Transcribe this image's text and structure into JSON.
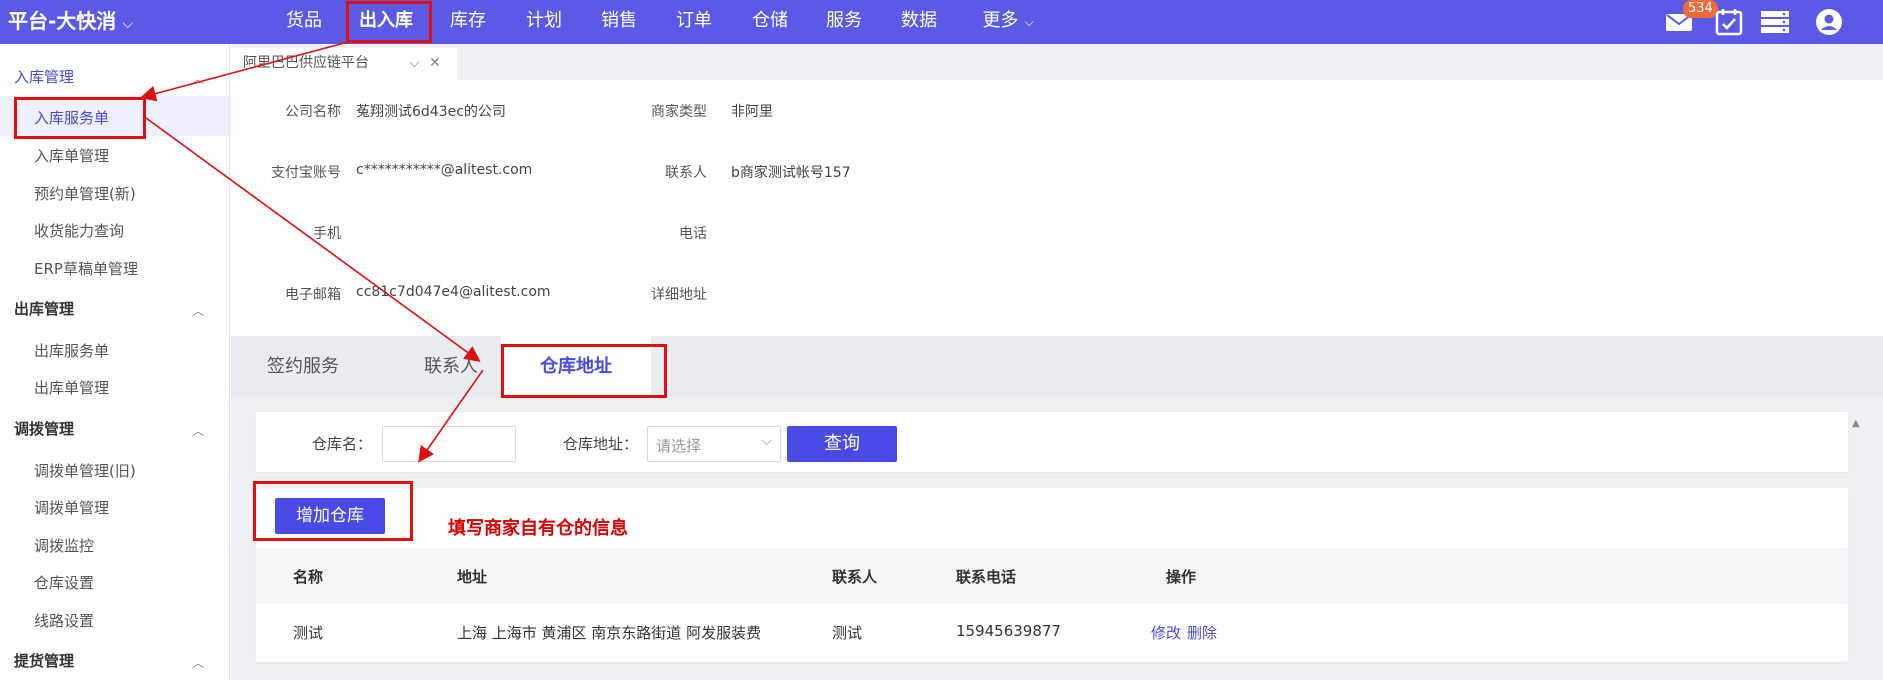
{
  "app": {
    "brand": "平台-大快消"
  },
  "nav": {
    "items": [
      "货品",
      "出入库",
      "库存",
      "计划",
      "销售",
      "订单",
      "仓储",
      "服务",
      "数据"
    ],
    "more": "更多",
    "active_index": 1
  },
  "header_icons": {
    "mail_icon": "mail-icon",
    "mail_badge": "534",
    "calendar_icon": "calendar-check-icon",
    "list_icon": "server-list-icon",
    "user_icon": "user-avatar-icon"
  },
  "sidebar": {
    "groups": [
      {
        "title": "入库管理",
        "items": [
          "入库服务单",
          "入库单管理",
          "预约单管理(新)",
          "收货能力查询",
          "ERP草稿单管理"
        ]
      },
      {
        "title": "出库管理",
        "items": [
          "出库服务单",
          "出库单管理"
        ]
      },
      {
        "title": "调拨管理",
        "items": [
          "调拨单管理(旧)",
          "调拨单管理",
          "调拨监控",
          "仓库设置",
          "线路设置"
        ]
      },
      {
        "title": "提货管理",
        "items": []
      }
    ],
    "active_item": "入库服务单"
  },
  "content_tab": {
    "label": "阿里巴巴供应链平台"
  },
  "info": {
    "company_name_label": "公司名称",
    "company_name": "菟翔测试6d43ec的公司",
    "merchant_type_label": "商家类型",
    "merchant_type": "非阿里",
    "alipay_label": "支付宝账号",
    "alipay": "c***********@alitest.com",
    "contact_label": "联系人",
    "contact": "b商家测试帐号157",
    "mobile_label": "手机",
    "mobile": "",
    "phone_label": "电话",
    "phone": "",
    "email_label": "电子邮箱",
    "email": "cc81c7d047e4@alitest.com",
    "address_label": "详细地址",
    "address": ""
  },
  "section_tabs": [
    "签约服务",
    "联系人",
    "仓库地址"
  ],
  "search": {
    "name_label": "仓库名：",
    "name_value": "",
    "address_label": "仓库地址：",
    "address_placeholder": "请选择",
    "query_button": "查询"
  },
  "add_button": "增加仓库",
  "annotation": "填写商家自有仓的信息",
  "table": {
    "headers": [
      "名称",
      "地址",
      "联系人",
      "联系电话",
      "操作"
    ],
    "rows": [
      {
        "name": "测试",
        "address": "上海 上海市 黄浦区 南京东路街道 阿发服装费",
        "contact": "测试",
        "phone": "15945639877",
        "edit": "修改",
        "delete": "删除"
      }
    ]
  },
  "colors": {
    "brand": "#5a5ae6",
    "accent": "#4a4ae6",
    "annotation": "#e01010"
  }
}
